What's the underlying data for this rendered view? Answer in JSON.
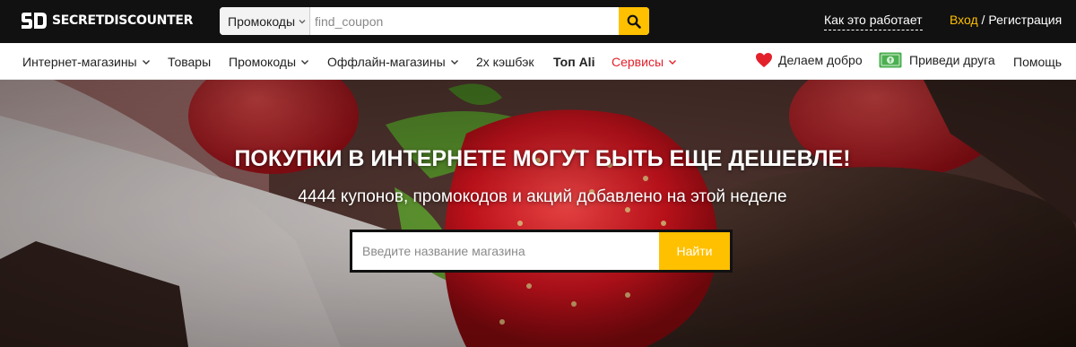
{
  "header": {
    "logo_text": "SECRETDISCOUNTER",
    "search": {
      "type_select": "Промокоды",
      "placeholder": "find_coupon"
    },
    "how_it_works": "Как это работает",
    "login": "Вход",
    "separator": " / ",
    "register": "Регистрация"
  },
  "nav": {
    "items": [
      {
        "label": "Интернет-магазины"
      },
      {
        "label": "Товары"
      },
      {
        "label": "Промокоды"
      },
      {
        "label": "Оффлайн-магазины"
      },
      {
        "label": "2х кэшбэк"
      },
      {
        "label": "Топ Ali"
      },
      {
        "label": "Сервисы"
      }
    ],
    "right": [
      {
        "label": "Делаем добро",
        "icon": "heart-icon"
      },
      {
        "label": "Приведи друга",
        "icon": "money-icon"
      },
      {
        "label": "Помощь"
      }
    ]
  },
  "hero": {
    "title": "ПОКУПКИ В ИНТЕРНЕТЕ МОГУТ БЫТЬ ЕЩЕ ДЕШЕВЛЕ!",
    "subtitle": "4444 купонов, промокодов и акций добавлено на этой неделе",
    "search_placeholder": "Введите название магазина",
    "search_button": "Найти"
  },
  "colors": {
    "accent": "#ffc000",
    "topbar": "#111111",
    "services": "#e3212b",
    "heart": "#e3212b",
    "money": "#4caf50"
  }
}
